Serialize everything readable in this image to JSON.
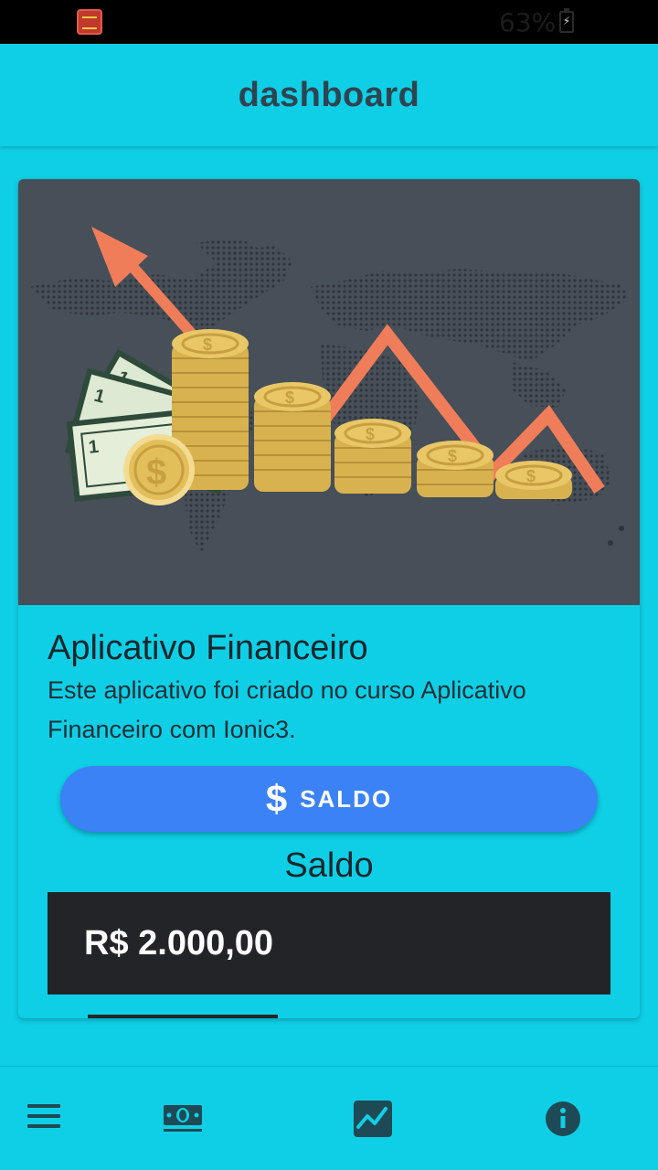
{
  "status_bar": {
    "battery_percent": "63%"
  },
  "header": {
    "title": "dashboard"
  },
  "card": {
    "title": "Aplicativo Financeiro",
    "description": "Este aplicativo foi criado no curso Aplicativo Financeiro com Ionic3.",
    "button_label": "SALDO",
    "saldo_heading": "Saldo",
    "balance": "R$ 2.000,00"
  },
  "tabs": [
    {
      "icon": "menu-icon"
    },
    {
      "icon": "cash-icon",
      "selected": true
    },
    {
      "icon": "trending-chart-icon"
    },
    {
      "icon": "info-icon"
    }
  ],
  "colors": {
    "background": "#0fcfe6",
    "button": "#3b82f6",
    "balance_box": "#232428",
    "tab_icon": "#1e4a55"
  }
}
